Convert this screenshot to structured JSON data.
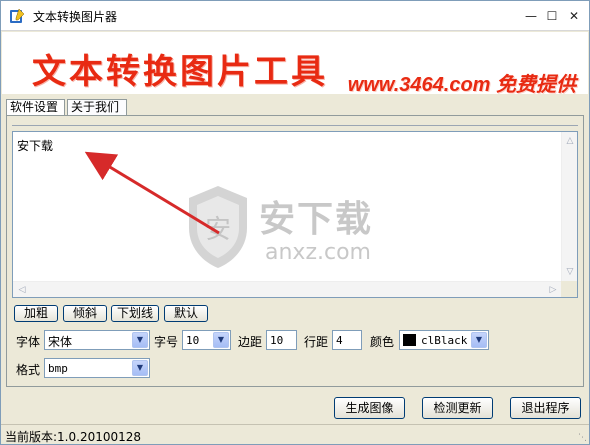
{
  "window": {
    "title": "文本转换图片器"
  },
  "banner": {
    "title": "文本转换图片工具",
    "subtitle": "www.3464.com 免费提供"
  },
  "tabs": [
    {
      "label": "软件设置",
      "active": true
    },
    {
      "label": "关于我们",
      "active": false
    }
  ],
  "editor": {
    "text": "安下载"
  },
  "watermark": {
    "cn": "安下载",
    "en": "anxz.com"
  },
  "style_buttons": {
    "bold": "加粗",
    "italic": "倾斜",
    "underline": "下划线",
    "default": "默认"
  },
  "settings": {
    "font_label": "字体",
    "font_value": "宋体",
    "size_label": "字号",
    "size_value": "10",
    "margin_label": "边距",
    "margin_value": "10",
    "line_spacing_label": "行距",
    "line_spacing_value": "4",
    "color_label": "颜色",
    "color_value": "clBlack",
    "format_label": "格式",
    "format_value": "bmp"
  },
  "actions": {
    "generate": "生成图像",
    "check_update": "检测更新",
    "exit": "退出程序"
  },
  "status": {
    "version": "当前版本:1.0.20100128"
  },
  "colors": {
    "accent_red": "#e82a12",
    "swatch": "#000000"
  }
}
